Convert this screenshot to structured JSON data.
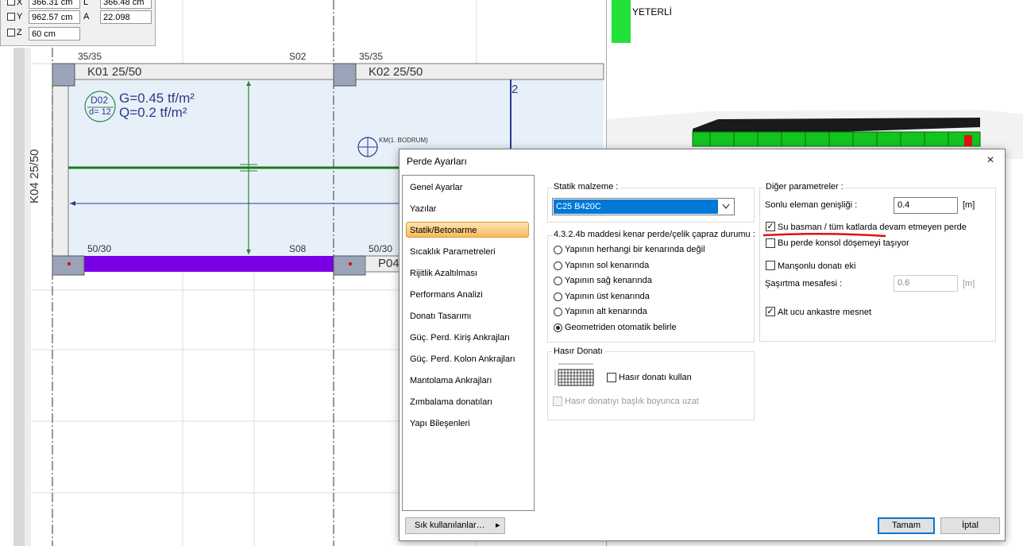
{
  "coord_panel": {
    "x_label": "X",
    "x_value": "366.31 cm",
    "y_label": "Y",
    "y_value": "962.57 cm",
    "z_label": "Z",
    "z_value": "60 cm",
    "l_label": "L",
    "l_value": "366.48 cm",
    "a_label": "A",
    "a_value": "22.098"
  },
  "cad": {
    "col_label_1": "35/35",
    "col_label_2": "S02",
    "col_label_3": "35/35",
    "beam_k01": "K01 25/50",
    "beam_k02": "K02 25/50",
    "beam_k04": "K04 25/50",
    "slab_id": "D02",
    "slab_thickness": "d= 12",
    "slab_g": "G=0.45 tf/m²",
    "slab_q": "Q=0.2 tf/m²",
    "km_label": "KM(1. BODRUM)",
    "dim_2": "2",
    "col_label_4": "50/30",
    "col_label_5": "S08",
    "col_label_6": "50/30",
    "wall_p04": "P04"
  },
  "view3d": {
    "status_text": "YETERLİ",
    "status_color": "#22e03a"
  },
  "dialog": {
    "title": "Perde Ayarları",
    "close_icon": "×",
    "nav": [
      "Genel Ayarlar",
      "Yazılar",
      "Statik/Betonarme",
      "Sıcaklık Parametreleri",
      "Rijitlik Azaltılması",
      "Performans Analizi",
      "Donatı Tasarımı",
      "Güç. Perd. Kiriş Ankrajları",
      "Güç. Perd. Kolon Ankrajları",
      "Mantolama Ankrajları",
      "Zımbalama donatıları",
      "Yapı Bileşenleri"
    ],
    "selected_nav_index": 2,
    "static_material_label": "Statik malzeme :",
    "static_material_value": "C25 B420C",
    "edge_group_label": "4.3.2.4b maddesi kenar perde/çelik çapraz durumu :",
    "edge_options": [
      "Yapının herhangi bir kenarında değil",
      "Yapının sol kenarında",
      "Yapının sağ kenarında",
      "Yapının üst kenarında",
      "Yapının alt kenarında",
      "Geometriden otomatik belirle"
    ],
    "edge_selected_index": 5,
    "mesh_group_label": "Hasır Donatı",
    "mesh_use_label": "Hasır donatı kullan",
    "mesh_use_checked": false,
    "mesh_extend_label": "Hasır donatıyı başlık boyunca uzat",
    "other_group_label": "Diğer parametreler :",
    "fe_width_label": "Sonlu eleman genişliği :",
    "fe_width_value": "0.4",
    "fe_width_unit": "[m]",
    "wet_label": "Su basman / tüm katlarda devam etmeyen perde",
    "wet_checked": true,
    "cantilever_label": "Bu perde konsol döşemeyi taşıyor",
    "cantilever_checked": false,
    "sleeve_label": "Manşonlu donatı eki",
    "sleeve_checked": false,
    "stagger_label": "Şaşırtma mesafesi :",
    "stagger_value": "0.6",
    "stagger_unit": "[m]",
    "fixed_label": "Alt ucu ankastre mesnet",
    "fixed_checked": true,
    "favorites_label": "Sık kullanılanlar…",
    "favorites_arrow": "▸",
    "ok_label": "Tamam",
    "cancel_label": "İptal"
  }
}
